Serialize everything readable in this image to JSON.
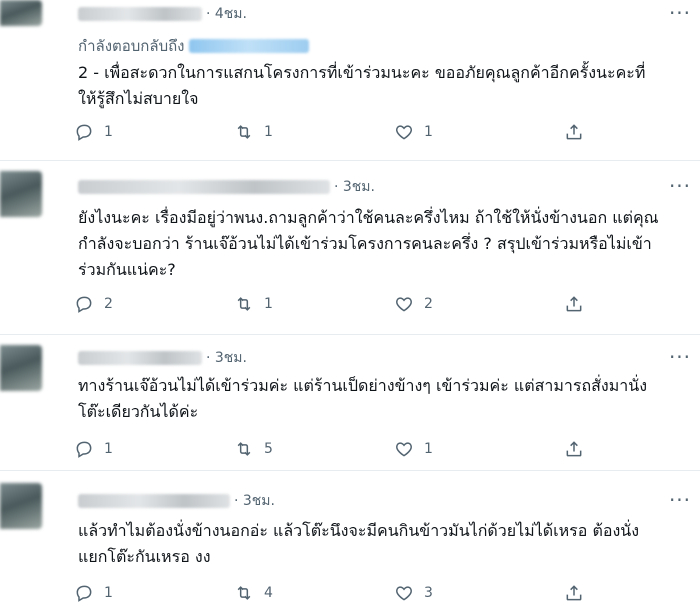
{
  "tweets": [
    {
      "time": "· 4ชม.",
      "replying_label": "กำลังตอบกลับถึง",
      "text": "2 - เพื่อสะดวกในการแสกนโครงการที่เข้าร่วมนะคะ ขออภัยคุณลูกค้าอีกครั้งนะคะที่\nให้รู้สึกไม่สบายใจ",
      "replies": "1",
      "retweets": "1",
      "likes": "1"
    },
    {
      "time": "· 3ชม.",
      "text": "ยังไงนะคะ เรื่องมีอยู่ว่าพนง.ถามลูกค้าว่าใช้คนละครึ่งไหม ถ้าใช้ให้นั่งข้างนอก แต่คุณ\nกำลังจะบอกว่า ร้านเจ๊อ้วนไม่ได้เข้าร่วมโครงการคนละครึ่ง ? สรุปเข้าร่วมหรือไม่เข้า\nร่วมกันแน่คะ?",
      "replies": "2",
      "retweets": "1",
      "likes": "2"
    },
    {
      "time": "· 3ชม.",
      "text": "ทางร้านเจ๊อ้วนไม่ได้เข้าร่วมค่ะ แต่ร้านเป็ดย่างข้างๆ เข้าร่วมค่ะ แต่สามารถสั่งมานั่ง\nโต๊ะเดียวกันได้ค่ะ",
      "replies": "1",
      "retweets": "5",
      "likes": "1"
    },
    {
      "time": "· 3ชม.",
      "text": "แล้วทำไมต้องนั่งข้างนอกอ่ะ แล้วโต๊ะนึงจะมีคนกินข้าวมันไก่ด้วยไม่ได้เหรอ ต้องนั่ง\nแยกโต๊ะกันเหรอ งง",
      "replies": "1",
      "retweets": "4",
      "likes": "3"
    }
  ],
  "icons": {
    "reply": "reply-icon",
    "retweet": "retweet-icon",
    "like": "like-icon",
    "share": "share-icon",
    "more": "more-icon"
  },
  "colors": {
    "text": "#0f1419",
    "secondary": "#536471",
    "divider": "#e6ecf0"
  }
}
